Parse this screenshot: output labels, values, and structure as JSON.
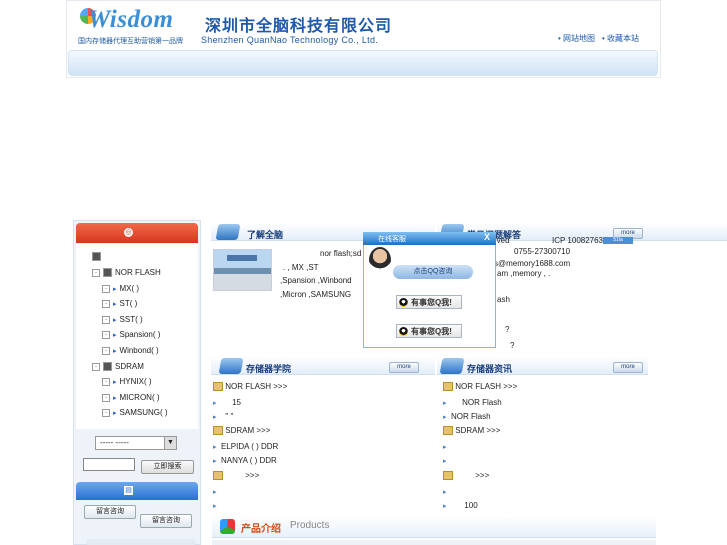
{
  "header": {
    "logo": "Wisdom",
    "tagline_cn": "国内存储器代理互助营销第一品牌",
    "company_cn": "深圳市全脑科技有限公司",
    "company_en": "Shenzhen QuanNao Technology Co., Ltd.",
    "links": [
      "• 网站地图",
      "• 收藏本站"
    ]
  },
  "sidebar": {
    "tree": [
      {
        "label": "",
        "level": 0
      },
      {
        "label": "NOR FLASH",
        "level": 1
      },
      {
        "label": "MX(  )",
        "level": 2
      },
      {
        "label": "ST(  )",
        "level": 2
      },
      {
        "label": "SST(  )",
        "level": 2
      },
      {
        "label": "Spansion(  )",
        "level": 2
      },
      {
        "label": "Winbond(  )",
        "level": 2
      },
      {
        "label": "SDRAM",
        "level": 1
      },
      {
        "label": "HYNIX(  )",
        "level": 2
      },
      {
        "label": "MICRON(  )",
        "level": 2
      },
      {
        "label": "SAMSUNG(  )",
        "level": 2
      }
    ],
    "select_value": "-----      -----",
    "search_button": "立即搜索",
    "msg_button_1": "留言咨询",
    "msg_button_2": "留言咨询"
  },
  "about": {
    "title": "了解全脑",
    "lines": [
      "nor flash;sd",
      ".        ,     MX    ,ST",
      ",Spansion   ,Winbond",
      ",Micron   ,SAMSUNG"
    ]
  },
  "faq": {
    "title": "常见问题解答",
    "lines": [
      "rved",
      "0755-27300710",
      "s@memory1688.com",
      "am   ,memory   ,        .",
      "ash",
      "?",
      "?"
    ],
    "icp": "ICP 10082763",
    "icp_badge": "51la"
  },
  "academy": {
    "title": "存储器学院",
    "more": "more",
    "lines": [
      "NOR FLASH      >>>",
      "15",
      "\"       \"",
      "SDRAM      >>>",
      "ELPIDA (   ) DDR",
      "NANYA (  ) DDR",
      ">>>",
      "",
      ""
    ]
  },
  "news": {
    "title": "存储器资讯",
    "more": "more",
    "lines": [
      "NOR FLASH      >>>",
      "NOR Flash",
      "NOR Flash",
      "SDRAM      >>>",
      "",
      "",
      ">>>",
      "",
      "100"
    ]
  },
  "chat": {
    "title": "在线客服",
    "close": "X",
    "banner": "点击QQ咨询",
    "qq1": "有事您Q我!",
    "qq2": "有事您Q我!"
  },
  "products": {
    "title_cn": "产品介绍",
    "title_en": "Products"
  }
}
